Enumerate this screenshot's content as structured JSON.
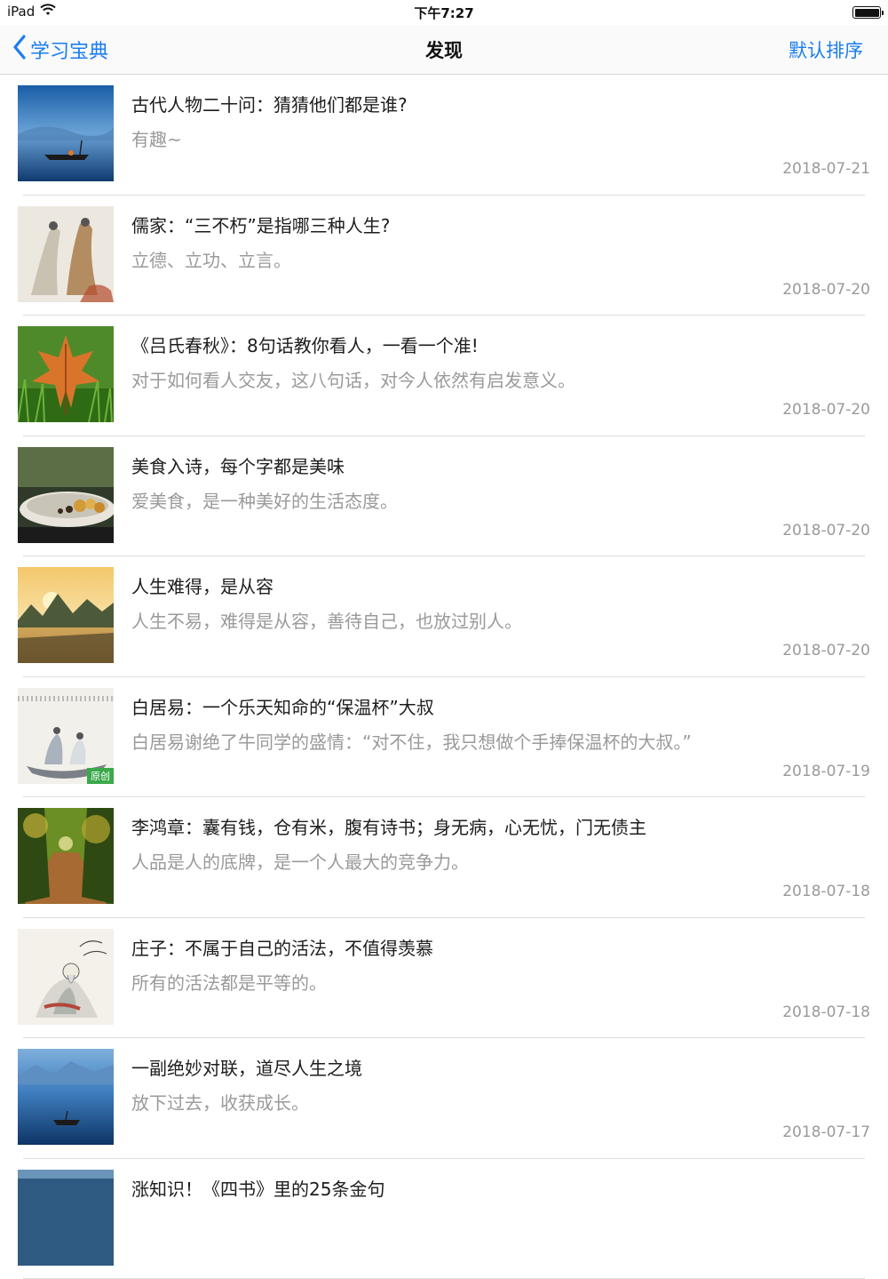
{
  "status_bar": {
    "device": "iPad",
    "time": "下午7:27",
    "icons": [
      "wifi-icon",
      "battery-icon"
    ]
  },
  "nav": {
    "back_label": "学习宝典",
    "title": "发现",
    "sort_label": "默认排序",
    "accent_color": "#1b7df0"
  },
  "articles": [
    {
      "title": "古代人物二十问：猜猜他们都是谁?",
      "summary": "有趣~",
      "date": "2018-07-21",
      "thumb": "misty-lake-boat"
    },
    {
      "title": "儒家：“三不朽”是指哪三种人生?",
      "summary": "立德、立功、立言。",
      "date": "2018-07-20",
      "thumb": "ink-painting-figures"
    },
    {
      "title": "《吕氏春秋》：8句话教你看人，一看一个准!",
      "summary": "对于如何看人交友，这八句话，对今人依然有启发意义。",
      "date": "2018-07-20",
      "thumb": "autumn-leaf-grass"
    },
    {
      "title": "美食入诗，每个字都是美味",
      "summary": "爱美食，是一种美好的生活态度。",
      "date": "2018-07-20",
      "thumb": "bowl-of-food"
    },
    {
      "title": "人生难得，是从容",
      "summary": "人生不易，难得是从容，善待自己，也放过别人。",
      "date": "2018-07-20",
      "thumb": "sunset-mountains"
    },
    {
      "title": "白居易：一个乐天知命的“保温杯”大叔",
      "summary": "白居易谢绝了牛同学的盛情：“对不住，我只想做个手捧保温杯的大叔。”",
      "date": "2018-07-19",
      "thumb": "ink-painting-boat",
      "badge": "原创"
    },
    {
      "title": "李鸿章：囊有钱，仓有米，腹有诗书；身无病，心无忧，门无债主",
      "summary": "人品是人的底牌，是一个人最大的竞争力。",
      "date": "2018-07-18",
      "thumb": "forest-road"
    },
    {
      "title": "庄子：不属于自己的活法，不值得羡慕",
      "summary": "所有的活法都是平等的。",
      "date": "2018-07-18",
      "thumb": "ink-painting-sage"
    },
    {
      "title": "一副绝妙对联，道尽人生之境",
      "summary": "放下过去，收获成长。",
      "date": "2018-07-17",
      "thumb": "blue-lake-boat"
    },
    {
      "title": "涨知识！《四书》里的25条金句",
      "summary": "",
      "date": "",
      "thumb": "blue-water"
    }
  ]
}
